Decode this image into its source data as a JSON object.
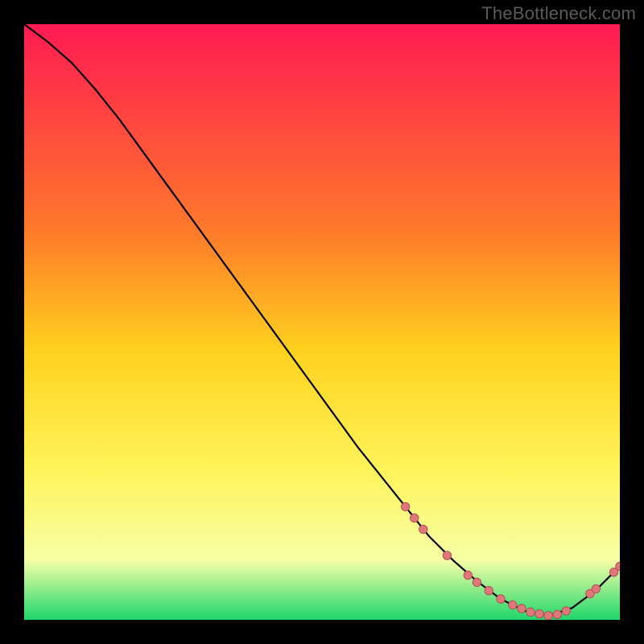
{
  "watermark": "TheBottleneck.com",
  "colors": {
    "gradient_top": "#ff1a52",
    "gradient_mid1": "#ff7a2a",
    "gradient_mid2": "#ffd21f",
    "gradient_mid3": "#fff45a",
    "gradient_mid4": "#f6ffa6",
    "gradient_bottom": "#1fd66b",
    "curve": "#000000",
    "marker_fill": "#e0787b",
    "marker_stroke": "#b25053"
  },
  "chart_data": {
    "type": "line",
    "title": "",
    "xlabel": "",
    "ylabel": "",
    "xlim": [
      0,
      100
    ],
    "ylim": [
      0,
      100
    ],
    "series": [
      {
        "name": "curve",
        "x": [
          0,
          4,
          8,
          12,
          16,
          20,
          24,
          28,
          32,
          36,
          40,
          44,
          48,
          52,
          56,
          60,
          64,
          68,
          72,
          76,
          80,
          84,
          88,
          92,
          96,
          100
        ],
        "y": [
          100,
          97,
          93.5,
          89,
          84,
          78.5,
          73,
          67.5,
          62,
          56.5,
          51,
          45.5,
          40,
          34.5,
          29,
          24,
          19,
          14,
          10,
          6.5,
          3.5,
          1.5,
          0.7,
          2,
          5,
          9
        ]
      }
    ],
    "markers": [
      {
        "x": 64.0,
        "y": 19.0
      },
      {
        "x": 65.5,
        "y": 17.1
      },
      {
        "x": 67.0,
        "y": 15.2
      },
      {
        "x": 71.0,
        "y": 10.8
      },
      {
        "x": 74.5,
        "y": 7.5
      },
      {
        "x": 76.0,
        "y": 6.3
      },
      {
        "x": 78.0,
        "y": 4.9
      },
      {
        "x": 80.0,
        "y": 3.5
      },
      {
        "x": 82.0,
        "y": 2.5
      },
      {
        "x": 83.5,
        "y": 1.9
      },
      {
        "x": 85.0,
        "y": 1.3
      },
      {
        "x": 86.5,
        "y": 1.0
      },
      {
        "x": 88.0,
        "y": 0.7
      },
      {
        "x": 89.5,
        "y": 0.9
      },
      {
        "x": 91.0,
        "y": 1.5
      },
      {
        "x": 95.0,
        "y": 4.4
      },
      {
        "x": 96.0,
        "y": 5.2
      },
      {
        "x": 99.0,
        "y": 8.0
      },
      {
        "x": 100.0,
        "y": 9.0
      }
    ]
  }
}
